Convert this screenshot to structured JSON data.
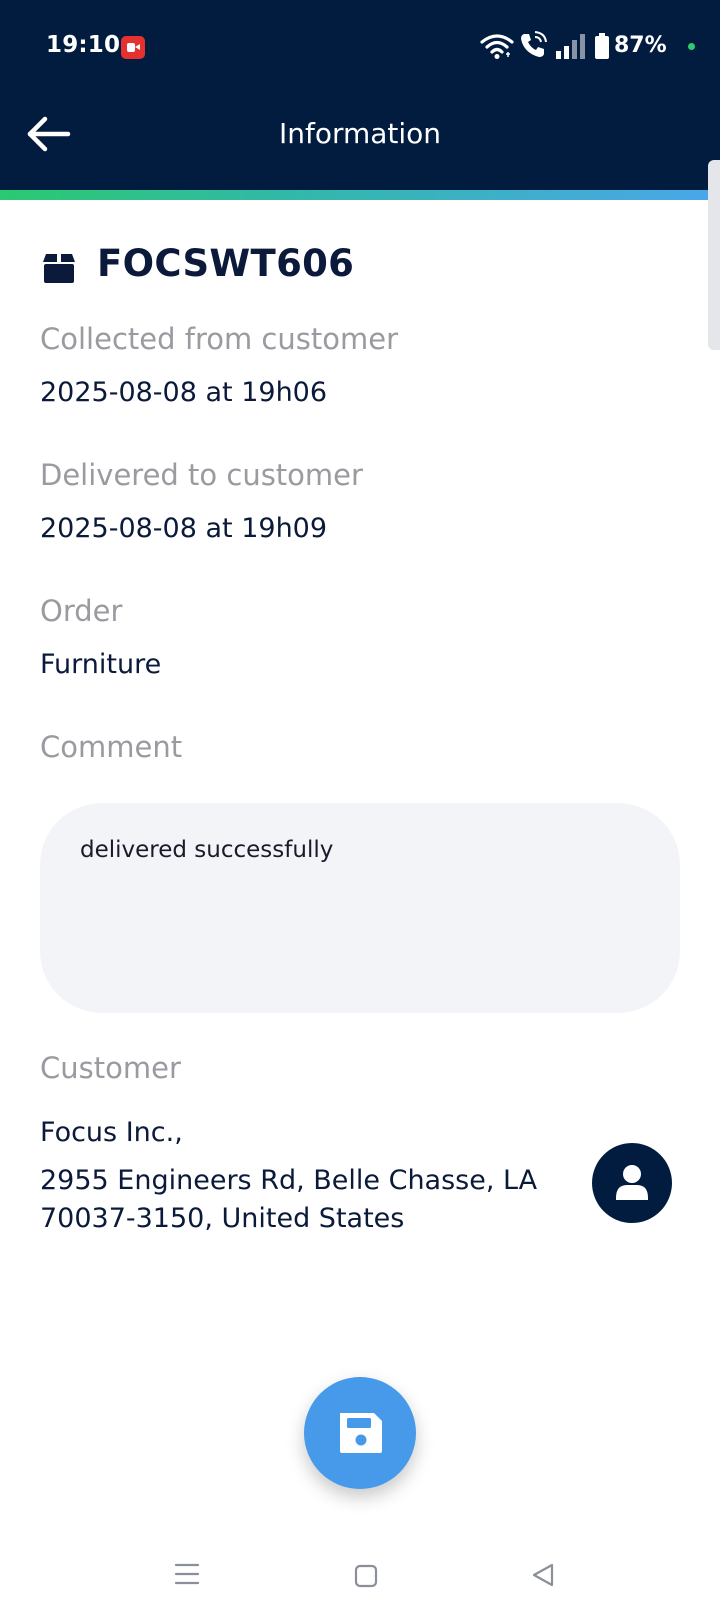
{
  "status_bar": {
    "time": "19:10",
    "battery_percent": "87%",
    "icons": [
      "screen-record-icon",
      "wifi-icon",
      "wifi-call-icon",
      "signal-icon",
      "battery-icon"
    ]
  },
  "app_bar": {
    "title": "Information",
    "back_icon": "arrow-left-icon"
  },
  "colors": {
    "app_bar": "#021c40",
    "gradient_start": "#2bc971",
    "gradient_end": "#4aa6ea",
    "fab": "#4799ea",
    "label": "#9a9aa0",
    "value": "#0b1a3a"
  },
  "shipment": {
    "icon": "package-icon",
    "id": "FOCSWT606"
  },
  "fields": {
    "collected_label": "Collected from customer",
    "collected_value": "2025-08-08 at 19h06",
    "delivered_label": "Delivered to customer",
    "delivered_value": "2025-08-08 at 19h09",
    "order_label": "Order",
    "order_value": "Furniture",
    "comment_label": "Comment",
    "comment_value": "delivered successfully",
    "customer_label": "Customer",
    "customer_name": "Focus Inc.,",
    "customer_address_line1": "2955 Engineers Rd, Belle Chasse, LA",
    "customer_address_line2": "70037-3150, United States"
  },
  "actions": {
    "customer_icon": "user-icon",
    "save_icon": "floppy-disk-icon"
  },
  "nav_bar": {
    "icons": [
      "recents-icon",
      "home-icon",
      "back-triangle-icon"
    ]
  }
}
